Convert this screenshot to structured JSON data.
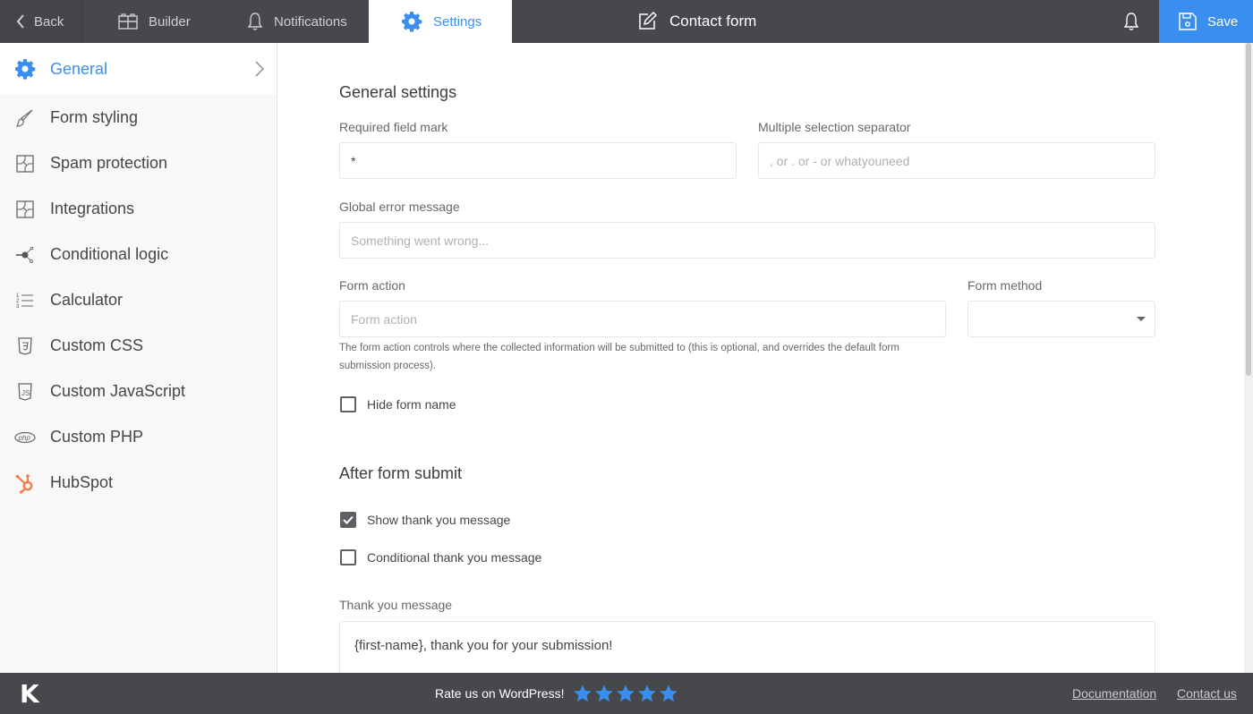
{
  "topbar": {
    "back_label": "Back",
    "tabs": [
      {
        "label": "Builder",
        "icon": "builder-icon",
        "active": false
      },
      {
        "label": "Notifications",
        "icon": "bell-icon",
        "active": false
      },
      {
        "label": "Settings",
        "icon": "gear-icon",
        "active": true
      }
    ],
    "form_title": "Contact form",
    "save_label": "Save"
  },
  "sidebar": {
    "items": [
      {
        "label": "General",
        "icon": "gear-icon",
        "active": true
      },
      {
        "label": "Form styling",
        "icon": "brush-icon",
        "active": false
      },
      {
        "label": "Spam protection",
        "icon": "puzzle-icon",
        "active": false
      },
      {
        "label": "Integrations",
        "icon": "puzzle-icon",
        "active": false
      },
      {
        "label": "Conditional logic",
        "icon": "branch-icon",
        "active": false
      },
      {
        "label": "Calculator",
        "icon": "numbered-list-icon",
        "active": false
      },
      {
        "label": "Custom CSS",
        "icon": "css3-icon",
        "active": false
      },
      {
        "label": "Custom JavaScript",
        "icon": "js-icon",
        "active": false
      },
      {
        "label": "Custom PHP",
        "icon": "php-icon",
        "active": false
      },
      {
        "label": "HubSpot",
        "icon": "hubspot-icon",
        "active": false
      }
    ]
  },
  "general": {
    "title": "General settings",
    "required_mark_label": "Required field mark",
    "required_mark_value": "*",
    "separator_label": "Multiple selection separator",
    "separator_placeholder": ", or . or - or whatyouneed",
    "error_label": "Global error message",
    "error_placeholder": "Something went wrong...",
    "action_label": "Form action",
    "action_placeholder": "Form action",
    "action_help": "The form action controls where the collected information will be submitted to (this is optional, and overrides the default form submission process).",
    "method_label": "Form method",
    "method_value": "",
    "hide_name_label": "Hide form name",
    "hide_name_checked": false
  },
  "after_submit": {
    "title": "After form submit",
    "show_thanks_label": "Show thank you message",
    "show_thanks_checked": true,
    "conditional_thanks_label": "Conditional thank you message",
    "conditional_thanks_checked": false,
    "thanks_message_label": "Thank you message",
    "thanks_message_value": "{first-name}, thank you for your submission!"
  },
  "footer": {
    "logo": "K",
    "rate_label": "Rate us on WordPress!",
    "stars": 5,
    "star_color": "#3a8ef0",
    "documentation_label": "Documentation",
    "contact_label": "Contact us"
  },
  "colors": {
    "accent": "#3a8ef0",
    "topbar_bg": "#47484b",
    "hubspot": "#f57b4b"
  }
}
